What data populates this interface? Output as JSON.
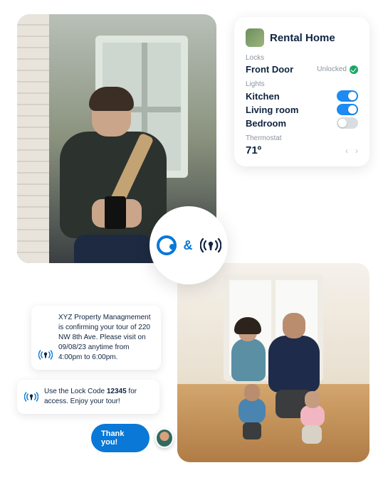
{
  "smart_card": {
    "title": "Rental Home",
    "locks_label": "Locks",
    "lock_name": "Front Door",
    "lock_status": "Unlocked",
    "lights_label": "Lights",
    "lights": [
      {
        "name": "Kitchen",
        "on": true
      },
      {
        "name": "Living room",
        "on": true
      },
      {
        "name": "Bedroom",
        "on": false
      }
    ],
    "thermostat_label": "Thermostat",
    "thermostat_value": "71º"
  },
  "connector": {
    "separator": "&"
  },
  "chat": {
    "msg1": "XYZ Property Managmement is confirming your tour of 220 NW 8th Ave. Please visit on 09/08/23 anytime from 4:00pm to 6:00pm.",
    "msg2_pre": "Use the Lock Code ",
    "msg2_code": "12345",
    "msg2_post": " for access. Enjoy your tour!",
    "reply": "Thank you!"
  }
}
